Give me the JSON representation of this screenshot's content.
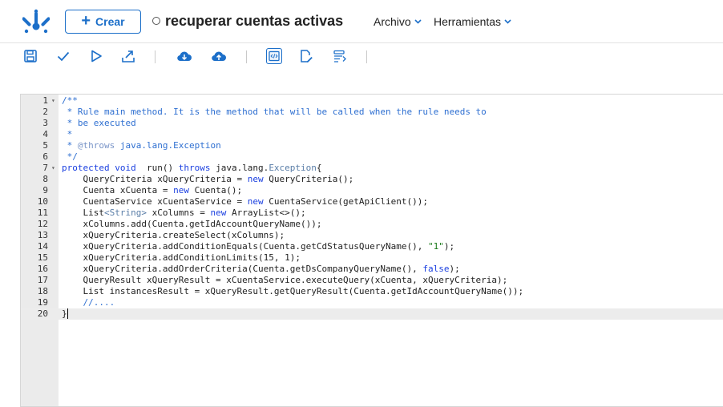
{
  "header": {
    "create_label": "Crear",
    "title": "recuperar cuentas activas",
    "menus": [
      "Archivo",
      "Herramientas"
    ]
  },
  "toolbar": {
    "icons": [
      "save-icon",
      "check-icon",
      "run-icon",
      "export-icon",
      "download-cloud-icon",
      "upload-cloud-icon",
      "code-view-icon",
      "edit-document-icon",
      "format-list-icon"
    ]
  },
  "editor": {
    "active_line": 20,
    "lines": [
      {
        "n": "1",
        "fold": true,
        "tokens": [
          [
            "cm",
            "/**"
          ]
        ]
      },
      {
        "n": "2",
        "tokens": [
          [
            "cm",
            " * Rule main method. It is the method that will be called when the rule needs to"
          ]
        ]
      },
      {
        "n": "3",
        "tokens": [
          [
            "cm",
            " * be executed"
          ]
        ]
      },
      {
        "n": "4",
        "tokens": [
          [
            "cm",
            " *"
          ]
        ]
      },
      {
        "n": "5",
        "tokens": [
          [
            "cm",
            " * "
          ],
          [
            "cg",
            "@throws"
          ],
          [
            "cm",
            " java.lang.Exception"
          ]
        ]
      },
      {
        "n": "6",
        "tokens": [
          [
            "cm",
            " */"
          ]
        ]
      },
      {
        "n": "7",
        "fold": true,
        "tokens": [
          [
            "kw",
            "protected void"
          ],
          [
            "",
            "  run() "
          ],
          [
            "kw",
            "throws"
          ],
          [
            "",
            " java.lang."
          ],
          [
            "gray",
            "Exception"
          ],
          [
            "",
            "{"
          ]
        ]
      },
      {
        "n": "8",
        "tokens": [
          [
            "",
            "    QueryCriteria xQueryCriteria = "
          ],
          [
            "kw",
            "new"
          ],
          [
            "",
            " QueryCriteria();"
          ]
        ]
      },
      {
        "n": "9",
        "tokens": [
          [
            "",
            "    Cuenta xCuenta = "
          ],
          [
            "kw",
            "new"
          ],
          [
            "",
            " Cuenta();"
          ]
        ]
      },
      {
        "n": "10",
        "tokens": [
          [
            "",
            "    CuentaService xCuentaService = "
          ],
          [
            "kw",
            "new"
          ],
          [
            "",
            " CuentaService(getApiClient());"
          ]
        ]
      },
      {
        "n": "11",
        "tokens": [
          [
            "",
            "    List"
          ],
          [
            "gray",
            "<String>"
          ],
          [
            "",
            " xColumns = "
          ],
          [
            "kw",
            "new"
          ],
          [
            "",
            " ArrayList<>();"
          ]
        ]
      },
      {
        "n": "12",
        "tokens": [
          [
            "",
            "    xColumns.add(Cuenta.getIdAccountQueryName());"
          ]
        ]
      },
      {
        "n": "13",
        "tokens": [
          [
            "",
            "    xQueryCriteria.createSelect(xColumns);"
          ]
        ]
      },
      {
        "n": "14",
        "tokens": [
          [
            "",
            "    xQueryCriteria.addConditionEquals(Cuenta.getCdStatusQueryName(), "
          ],
          [
            "str",
            "\"1\""
          ],
          [
            "",
            ");"
          ]
        ]
      },
      {
        "n": "15",
        "tokens": [
          [
            "",
            "    xQueryCriteria.addConditionLimits(15, 1);"
          ]
        ]
      },
      {
        "n": "16",
        "tokens": [
          [
            "",
            "    xQueryCriteria.addOrderCriteria(Cuenta.getDsCompanyQueryName(), "
          ],
          [
            "kw",
            "false"
          ],
          [
            "",
            ");"
          ]
        ]
      },
      {
        "n": "17",
        "tokens": [
          [
            "",
            "    QueryResult xQueryResult = xCuentaService.executeQuery(xCuenta, xQueryCriteria);"
          ]
        ]
      },
      {
        "n": "18",
        "tokens": [
          [
            "",
            "    List instancesResult = xQueryResult.getQueryResult(Cuenta.getIdAccountQueryName());"
          ]
        ]
      },
      {
        "n": "19",
        "tokens": [
          [
            "cm",
            "    //...."
          ]
        ]
      },
      {
        "n": "20",
        "tokens": [
          [
            "",
            "}"
          ]
        ]
      }
    ]
  }
}
